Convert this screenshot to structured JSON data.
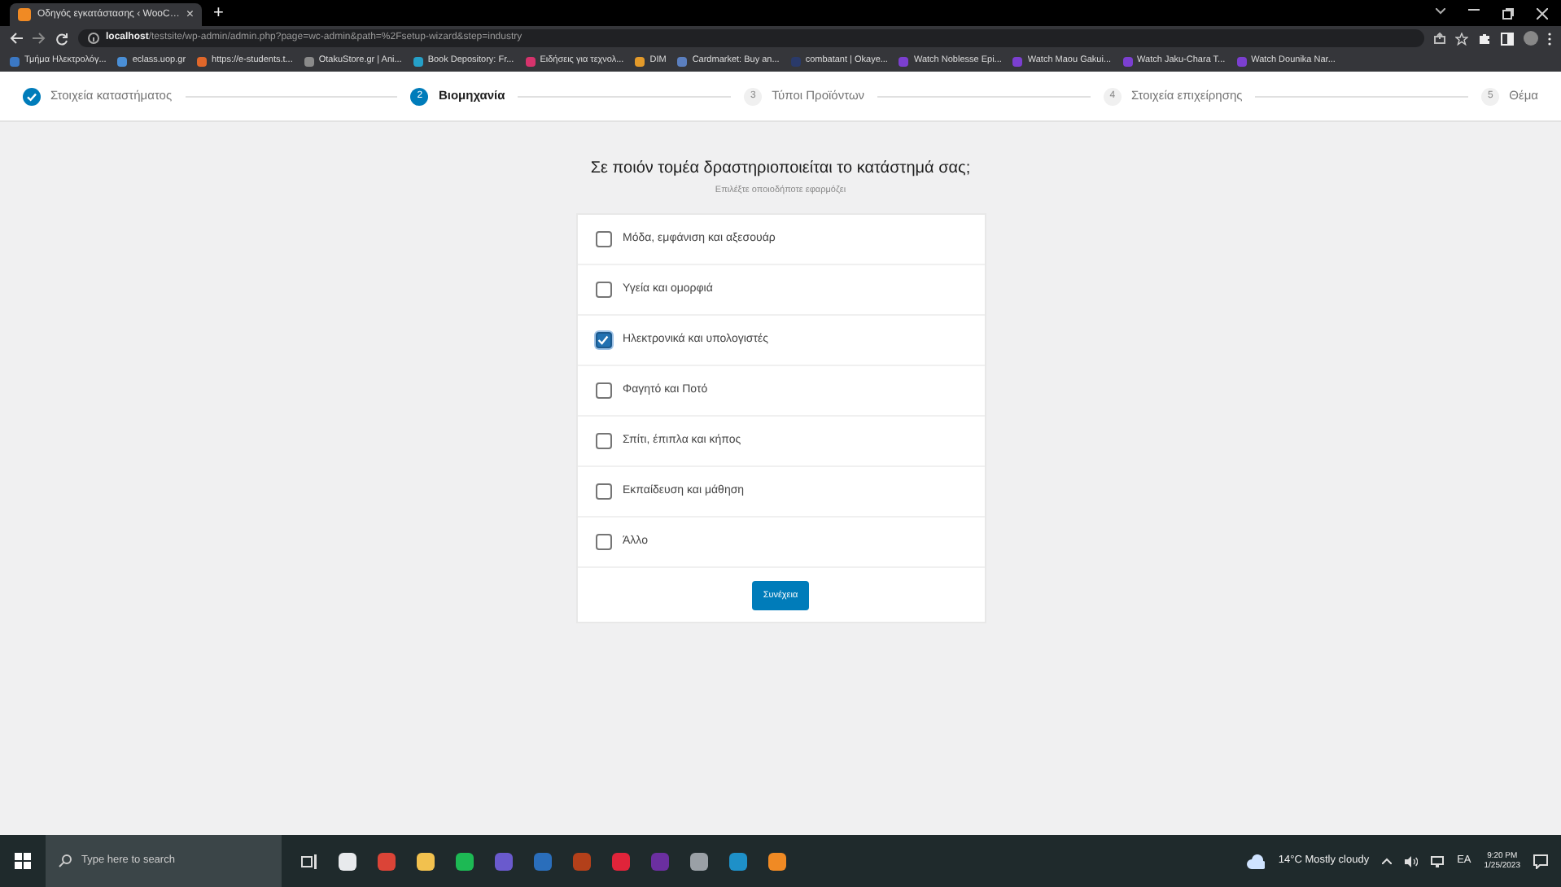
{
  "browser": {
    "tab": {
      "title": "Οδηγός εγκατάστασης ‹ WooC…",
      "close": "×"
    },
    "new_tab": "+",
    "address": {
      "host": "localhost",
      "path": "/testsite/wp-admin/admin.php?page=wc-admin&path=%2Fsetup-wizard&step=industry"
    },
    "bookmarks": [
      {
        "label": "Τμήμα Ηλεκτρολόγ...",
        "color": "#3b78c4"
      },
      {
        "label": "eclass.uop.gr",
        "color": "#4a8fd6"
      },
      {
        "label": "https://e-students.t...",
        "color": "#e0672a"
      },
      {
        "label": "OtakuStore.gr | Ani...",
        "color": "#8a8a8a"
      },
      {
        "label": "Book Depository: Fr...",
        "color": "#25a0c8"
      },
      {
        "label": "Ειδήσεις για τεχνολ...",
        "color": "#d6336c"
      },
      {
        "label": "DIM",
        "color": "#e39a2a"
      },
      {
        "label": "Cardmarket: Buy an...",
        "color": "#5b7fbf"
      },
      {
        "label": "combatant | Okaye...",
        "color": "#2a3a6a"
      },
      {
        "label": "Watch Noblesse Epi...",
        "color": "#7b3fd0"
      },
      {
        "label": "Watch Maou Gakui...",
        "color": "#7b3fd0"
      },
      {
        "label": "Watch Jaku-Chara T...",
        "color": "#7b3fd0"
      },
      {
        "label": "Watch Dounika Nar...",
        "color": "#7b3fd0"
      }
    ]
  },
  "steps": [
    {
      "label": "Στοιχεία καταστήματος",
      "kind": "done"
    },
    {
      "label": "Βιομηχανία",
      "number": "2",
      "kind": "current"
    },
    {
      "label": "Τύποι Προϊόντων",
      "number": "3",
      "kind": "upcoming"
    },
    {
      "label": "Στοιχεία επιχείρησης",
      "number": "4",
      "kind": "upcoming"
    },
    {
      "label": "Θέμα",
      "number": "5",
      "kind": "upcoming"
    }
  ],
  "question": {
    "title": "Σε ποιόν τομέα δραστηριοποιείται το κατάστημά σας;",
    "subtitle": "Επιλέξτε οποιοδήποτε εφαρμόζει"
  },
  "options": [
    {
      "label": "Μόδα, εμφάνιση και αξεσουάρ",
      "checked": false
    },
    {
      "label": "Υγεία και ομορφιά",
      "checked": false
    },
    {
      "label": "Ηλεκτρονικά και υπολογιστές",
      "checked": true
    },
    {
      "label": "Φαγητό και Ποτό",
      "checked": false
    },
    {
      "label": "Σπίτι, έπιπλα και κήπος",
      "checked": false
    },
    {
      "label": "Εκπαίδευση και μάθηση",
      "checked": false
    },
    {
      "label": "Άλλο",
      "checked": false
    }
  ],
  "continue_button": "Συνέχεια",
  "taskbar": {
    "search_placeholder": "Type here to search",
    "apps": [
      {
        "color": "#e8eaed"
      },
      {
        "color": "#db4437"
      },
      {
        "color": "#f2c14e"
      },
      {
        "color": "#1db954"
      },
      {
        "color": "#6a5acd"
      },
      {
        "color": "#2a6ebb"
      },
      {
        "color": "#b3401a"
      },
      {
        "color": "#e0243a"
      },
      {
        "color": "#6b2fa0"
      },
      {
        "color": "#9aa0a6"
      },
      {
        "color": "#1e90c8"
      },
      {
        "color": "#f08a24"
      }
    ],
    "weather": "14°C  Mostly cloudy",
    "language": "EA",
    "time": "9:20 PM",
    "date": "1/25/2023"
  }
}
